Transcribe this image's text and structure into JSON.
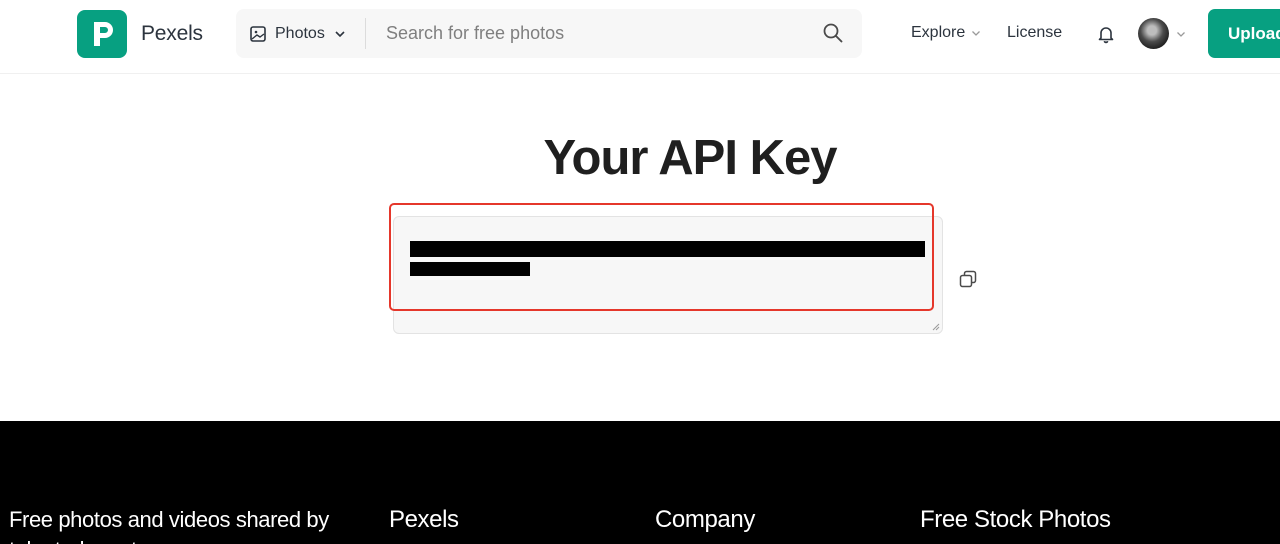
{
  "header": {
    "brand": "Pexels",
    "media_type": "Photos",
    "search_placeholder": "Search for free photos",
    "nav": {
      "explore": "Explore",
      "license": "License"
    },
    "upload_label": "Upload"
  },
  "main": {
    "title": "Your API Key",
    "api_key_redacted": true
  },
  "footer": {
    "tagline": "Free photos and videos shared by talented creators.",
    "columns": [
      "Pexels",
      "Company",
      "Free Stock Photos"
    ]
  },
  "colors": {
    "brand_green": "#07a081",
    "highlight_red": "#e5372b",
    "footer_bg": "#000000"
  },
  "icons": [
    "pexels-logo-icon",
    "image-icon",
    "chevron-down-icon",
    "search-icon",
    "bell-icon",
    "copy-icon",
    "resize-grip-icon"
  ]
}
